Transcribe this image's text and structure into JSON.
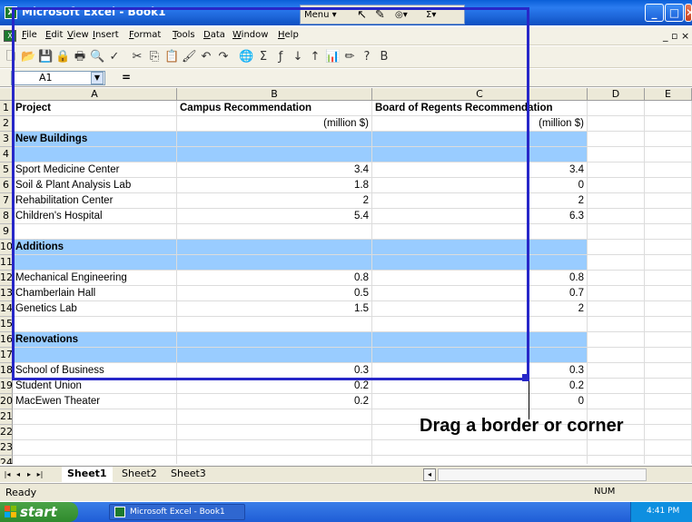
{
  "window": {
    "title": "Microsoft Excel - Book1",
    "icon_letter": "X",
    "buttons": {
      "minimize": "_",
      "maximize": "□",
      "close": "✕"
    }
  },
  "float_toolbar": {
    "menu_label": "Menu",
    "menu_arrow": "▾",
    "pointer": "↖",
    "pen": "✎",
    "circle": "◎▾",
    "sigma": "Σ▾"
  },
  "menubar": {
    "items": [
      "File",
      "Edit",
      "View",
      "Insert",
      "Format",
      "Tools",
      "Data",
      "Window",
      "Help"
    ],
    "doc_controls": "_ ▫ ×"
  },
  "toolbar": {
    "icons": [
      "new-icon",
      "open-icon",
      "save-icon",
      "permission-icon",
      "print-icon",
      "print-preview-icon",
      "spelling-icon",
      "cut-icon",
      "copy-icon",
      "paste-icon",
      "format-painter-icon",
      "undo-icon",
      "redo-icon",
      "hyperlink-icon",
      "autosum-icon",
      "function-icon",
      "sort-ascending-icon",
      "sort-descending-icon",
      "chart-wizard-icon",
      "drawing-icon",
      "help-icon",
      "bold-icon"
    ],
    "glyphs": [
      "🗋",
      "📂",
      "💾",
      "🔒",
      "🖶",
      "🔍",
      "✓",
      "✂",
      "⎘",
      "📋",
      "🖌",
      "↶",
      "↷",
      "🌐",
      "Σ",
      "ƒ",
      "↓",
      "↑",
      "📊",
      "✏",
      "?",
      "B"
    ]
  },
  "formula_bar": {
    "name_box": "A1",
    "name_arrow": "▼",
    "fx": "="
  },
  "columns": [
    "A",
    "B",
    "C",
    "D",
    "E"
  ],
  "rows": [
    {
      "n": "1",
      "a": "Project",
      "b": "Campus Recommendation",
      "c": "Board of Regents Recommendation",
      "band": false,
      "bold": true
    },
    {
      "n": "2",
      "a": "",
      "b": "(million $)",
      "c": "(million $)",
      "band": false,
      "bold": false
    },
    {
      "n": "3",
      "a": "New Buildings",
      "b": "",
      "c": "",
      "band": true,
      "bold": true
    },
    {
      "n": "4",
      "a": "",
      "b": "",
      "c": "",
      "band": true,
      "bold": false
    },
    {
      "n": "5",
      "a": "Sport Medicine Center",
      "b": "3.4",
      "c": "3.4",
      "band": false,
      "bold": false
    },
    {
      "n": "6",
      "a": "Soil & Plant Analysis Lab",
      "b": "1.8",
      "c": "0",
      "band": false,
      "bold": false
    },
    {
      "n": "7",
      "a": "Rehabilitation Center",
      "b": "2",
      "c": "2",
      "band": false,
      "bold": false
    },
    {
      "n": "8",
      "a": "Children's Hospital",
      "b": "5.4",
      "c": "6.3",
      "band": false,
      "bold": false
    },
    {
      "n": "9",
      "a": "",
      "b": "",
      "c": "",
      "band": false,
      "bold": false
    },
    {
      "n": "10",
      "a": "Additions",
      "b": "",
      "c": "",
      "band": true,
      "bold": true
    },
    {
      "n": "11",
      "a": "",
      "b": "",
      "c": "",
      "band": true,
      "bold": false
    },
    {
      "n": "12",
      "a": "Mechanical Engineering",
      "b": "0.8",
      "c": "0.8",
      "band": false,
      "bold": false
    },
    {
      "n": "13",
      "a": "Chamberlain Hall",
      "b": "0.5",
      "c": "0.7",
      "band": false,
      "bold": false
    },
    {
      "n": "14",
      "a": "Genetics Lab",
      "b": "1.5",
      "c": "2",
      "band": false,
      "bold": false
    },
    {
      "n": "15",
      "a": "",
      "b": "",
      "c": "",
      "band": false,
      "bold": false
    },
    {
      "n": "16",
      "a": "Renovations",
      "b": "",
      "c": "",
      "band": true,
      "bold": true
    },
    {
      "n": "17",
      "a": "",
      "b": "",
      "c": "",
      "band": true,
      "bold": false
    },
    {
      "n": "18",
      "a": "School of Business",
      "b": "0.3",
      "c": "0.3",
      "band": false,
      "bold": false
    },
    {
      "n": "19",
      "a": "Student Union",
      "b": "0.2",
      "c": "0.2",
      "band": false,
      "bold": false
    },
    {
      "n": "20",
      "a": "MacEwen Theater",
      "b": "0.2",
      "c": "0",
      "band": false,
      "bold": false
    },
    {
      "n": "21",
      "a": "",
      "b": "",
      "c": "",
      "band": false,
      "bold": false
    },
    {
      "n": "22",
      "a": "",
      "b": "",
      "c": "",
      "band": false,
      "bold": false
    },
    {
      "n": "23",
      "a": "",
      "b": "",
      "c": "",
      "band": false,
      "bold": false
    },
    {
      "n": "24",
      "a": "",
      "b": "",
      "c": "",
      "band": false,
      "bold": false
    }
  ],
  "callout": "Drag a border or corner",
  "sheet_tabs": {
    "nav": [
      "|◂",
      "◂",
      "▸",
      "▸|"
    ],
    "tabs": [
      "Sheet1",
      "Sheet2",
      "Sheet3"
    ],
    "scroll_left": "◂"
  },
  "status": {
    "ready": "Ready",
    "num": "NUM"
  },
  "taskbar": {
    "start": "start",
    "task": "Microsoft Excel - Book1",
    "clock": "4:41 PM"
  },
  "colors": {
    "band": "#99ccff",
    "selection": "#2727c8",
    "titlebar": "#1c63d6"
  }
}
